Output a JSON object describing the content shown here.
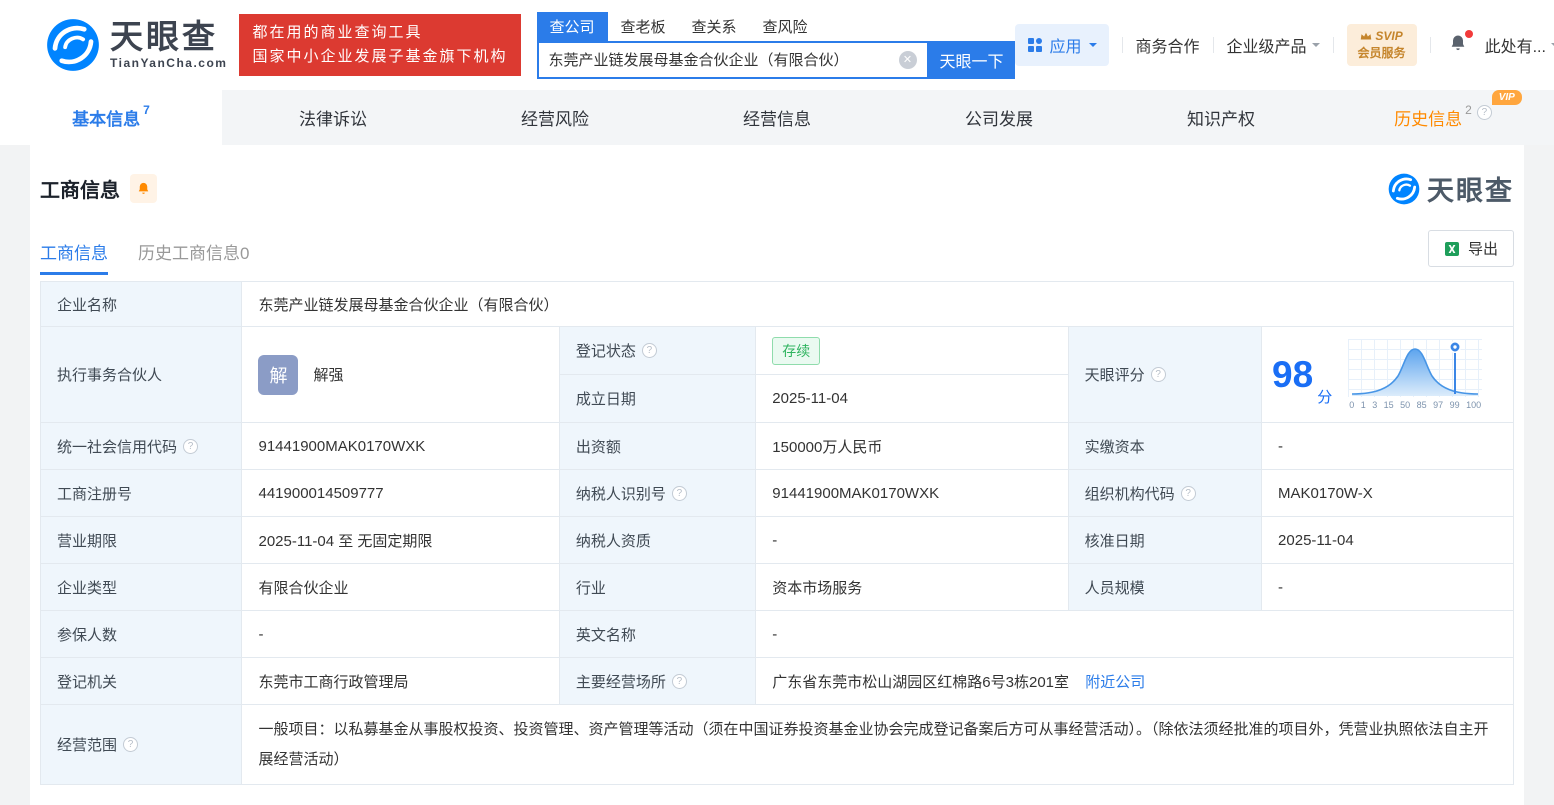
{
  "colors": {
    "accent_blue": "#2b7ce9",
    "brand_blue": "#0084ff",
    "banner_red": "#dc3a31",
    "history_orange": "#ff8a00",
    "status_green": "#2fb45f",
    "label_cell_bg": "#eff6fc",
    "score_blue": "#1a6ef5"
  },
  "header": {
    "brand": "天眼查",
    "brand_domain": "TianYanCha.com",
    "banner_line1": "都在用的商业查询工具",
    "banner_line2": "国家中小企业发展子基金旗下机构",
    "search_tabs": [
      "查公司",
      "查老板",
      "查关系",
      "查风险"
    ],
    "search_value": "东莞产业链发展母基金合伙企业（有限合伙）",
    "search_button": "天眼一下",
    "nav_apps": "应用",
    "nav_coop": "商务合作",
    "nav_enterprise": "企业级产品",
    "svip_line1": "SVIP",
    "svip_line2": "会员服务",
    "user_name": "此处有..."
  },
  "tabs": [
    {
      "label": "基本信息",
      "count": "7"
    },
    {
      "label": "法律诉讼"
    },
    {
      "label": "经营风险"
    },
    {
      "label": "经营信息"
    },
    {
      "label": "公司发展"
    },
    {
      "label": "知识产权"
    },
    {
      "label": "历史信息",
      "count": "2",
      "vip_tag": "VIP"
    }
  ],
  "section": {
    "title": "工商信息",
    "watermark": "天眼查",
    "subtabs": [
      "工商信息",
      "历史工商信息0"
    ],
    "export_label": "导出"
  },
  "fields": {
    "company_name_label": "企业名称",
    "company_name": "东莞产业链发展母基金合伙企业（有限合伙）",
    "partner_label": "执行事务合伙人",
    "partner_avatar": "解",
    "partner_name": "解强",
    "reg_status_label": "登记状态",
    "reg_status": "存续",
    "established_label": "成立日期",
    "established_date": "2025-11-04",
    "score_label": "天眼评分",
    "credit_code_label": "统一社会信用代码",
    "credit_code": "91441900MAK0170WXK",
    "capital_label": "出资额",
    "capital": "150000万人民币",
    "paid_capital_label": "实缴资本",
    "paid_capital": "-",
    "reg_number_label": "工商注册号",
    "reg_number": "441900014509777",
    "taxpayer_id_label": "纳税人识别号",
    "taxpayer_id": "91441900MAK0170WXK",
    "org_code_label": "组织机构代码",
    "org_code": "MAK0170W-X",
    "business_term_label": "营业期限",
    "business_term": "2025-11-04 至 无固定期限",
    "taxpayer_quality_label": "纳税人资质",
    "taxpayer_quality": "-",
    "approval_date_label": "核准日期",
    "approval_date": "2025-11-04",
    "company_type_label": "企业类型",
    "company_type": "有限合伙企业",
    "industry_label": "行业",
    "industry": "资本市场服务",
    "staff_size_label": "人员规模",
    "staff_size": "-",
    "insured_count_label": "参保人数",
    "insured_count": "-",
    "english_name_label": "英文名称",
    "english_name": "-",
    "reg_authority_label": "登记机关",
    "reg_authority": "东莞市工商行政管理局",
    "address_label": "主要经营场所",
    "address": "广东省东莞市松山湖园区红棉路6号3栋201室",
    "nearby_link": "附近公司",
    "business_scope_label": "经营范围",
    "business_scope": "一般项目：以私募基金从事股权投资、投资管理、资产管理等活动（须在中国证券投资基金业协会完成登记备案后方可从事经营活动）。（除依法须经批准的项目外，凭营业执照依法自主开展经营活动）"
  },
  "chart_data": {
    "type": "area",
    "title": "天眼评分",
    "score": 98,
    "score_unit": "分",
    "x_ticks": [
      0,
      1,
      3,
      15,
      50,
      85,
      97,
      99,
      100
    ],
    "marker_value": 98,
    "description": "bell-shaped score distribution curve with pin marker at the company score",
    "legend": false,
    "grid": true
  }
}
